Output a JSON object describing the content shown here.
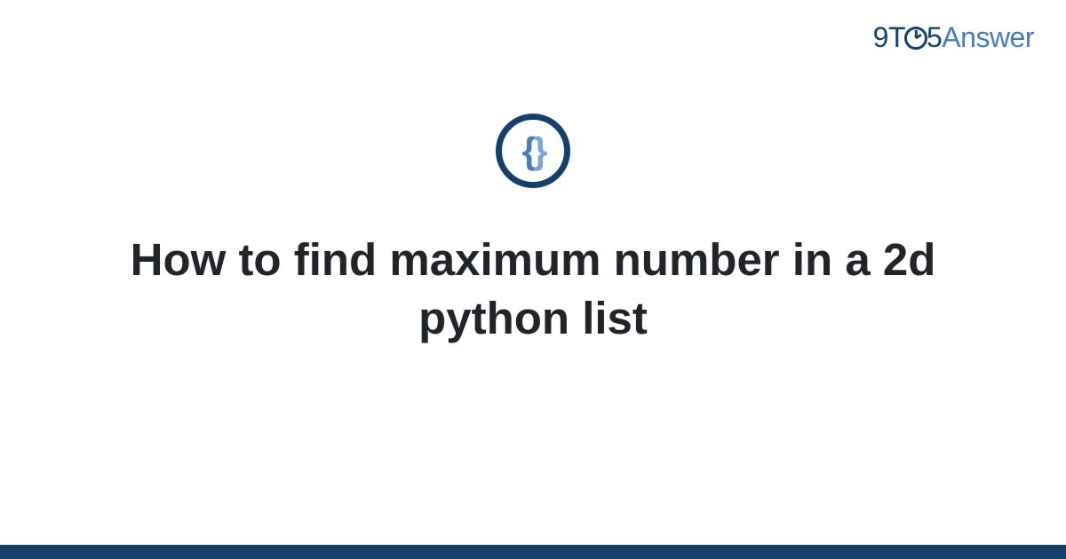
{
  "brand": {
    "prefix": "9T",
    "suffix": "5",
    "word": "Answer"
  },
  "icon": {
    "left_brace": "{",
    "right_brace": "}"
  },
  "title": "How to find maximum number in a 2d python list"
}
